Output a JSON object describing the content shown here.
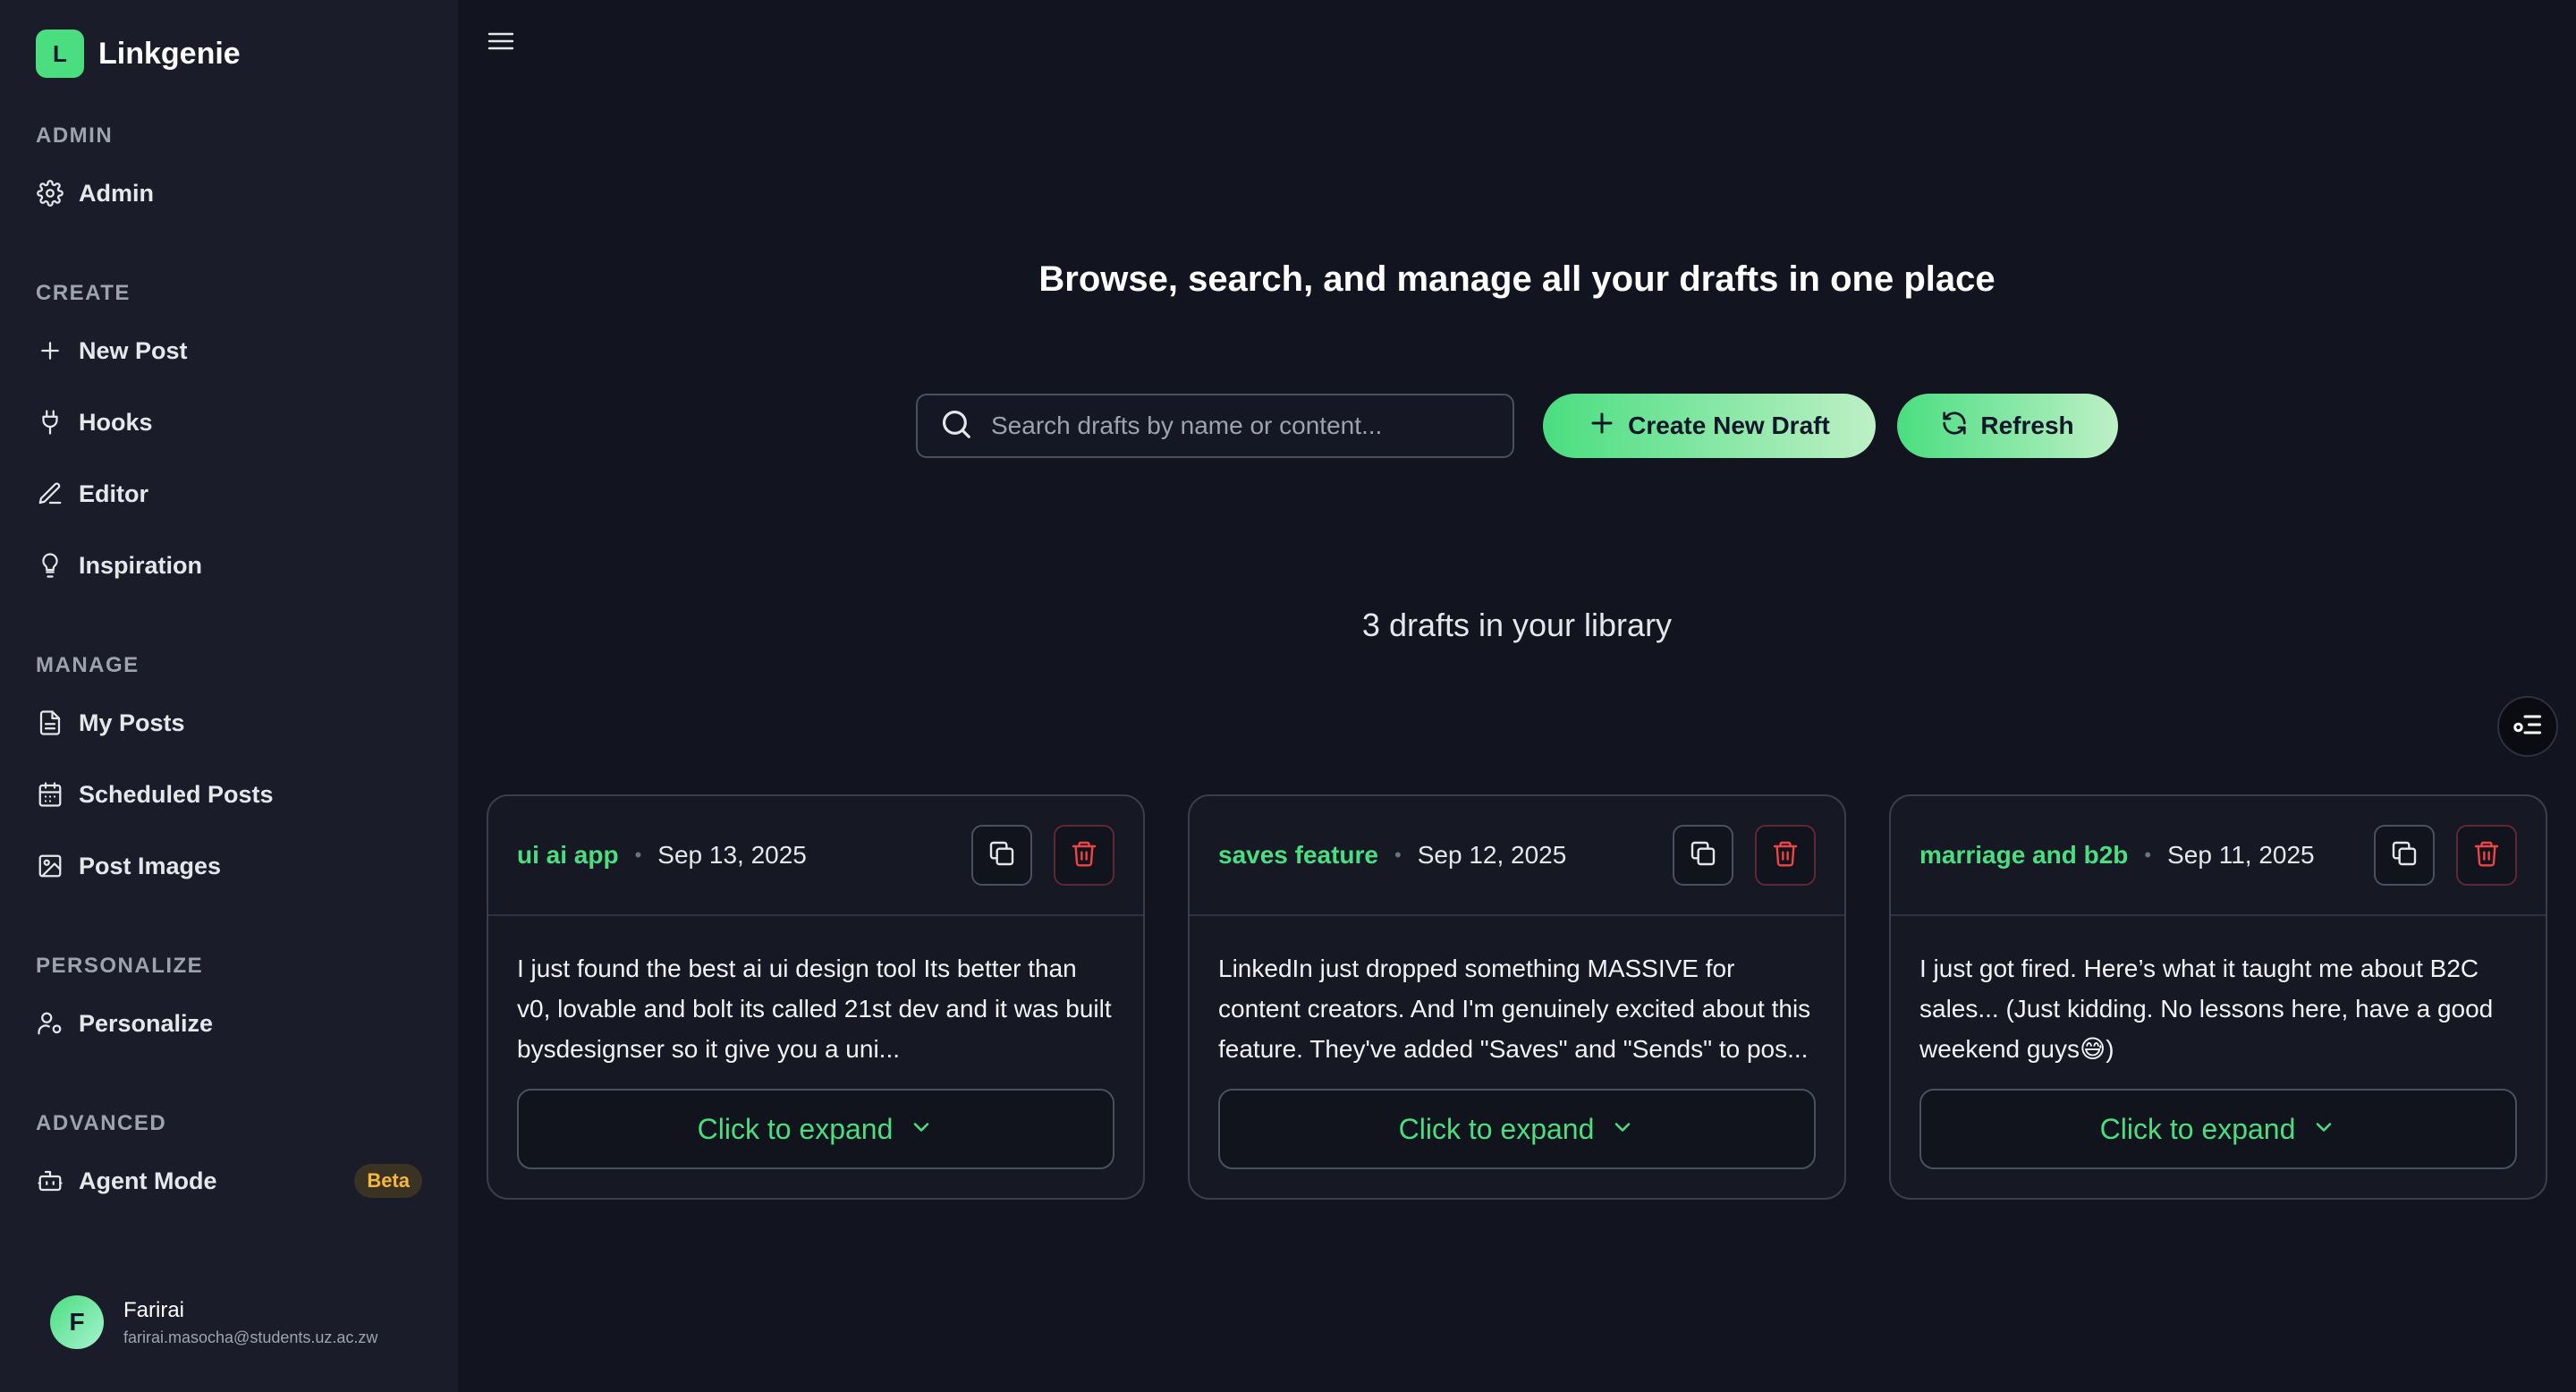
{
  "app": {
    "logo_letter": "L",
    "name": "Linkgenie"
  },
  "sidebar": {
    "sections": [
      {
        "title": "ADMIN",
        "items": [
          {
            "label": "Admin",
            "icon": "gear-icon"
          }
        ]
      },
      {
        "title": "CREATE",
        "items": [
          {
            "label": "New Post",
            "icon": "plus-icon"
          },
          {
            "label": "Hooks",
            "icon": "hook-icon"
          },
          {
            "label": "Editor",
            "icon": "pen-icon"
          },
          {
            "label": "Inspiration",
            "icon": "lightbulb-icon"
          }
        ]
      },
      {
        "title": "MANAGE",
        "items": [
          {
            "label": "My Posts",
            "icon": "document-icon"
          },
          {
            "label": "Scheduled Posts",
            "icon": "calendar-icon"
          },
          {
            "label": "Post Images",
            "icon": "image-icon"
          }
        ]
      },
      {
        "title": "PERSONALIZE",
        "items": [
          {
            "label": "Personalize",
            "icon": "user-settings-icon"
          }
        ]
      },
      {
        "title": "ADVANCED",
        "items": [
          {
            "label": "Agent Mode",
            "icon": "robot-icon",
            "badge": "Beta"
          }
        ]
      }
    ]
  },
  "user": {
    "initial": "F",
    "name": "Farirai",
    "email": "farirai.masocha@students.uz.ac.zw"
  },
  "main": {
    "heading": "Browse, search, and manage all your drafts in one place",
    "search": {
      "placeholder": "Search drafts by name or content...",
      "value": ""
    },
    "create_button": "Create New Draft",
    "refresh_button": "Refresh",
    "count_text": "3 drafts in your library"
  },
  "drafts": [
    {
      "name": "ui ai app",
      "date": "Sep 13, 2025",
      "preview": "I just found the best ai ui design tool Its better than v0, lovable and bolt its called 21st dev and it was built bysdesignser so it give you a uni...",
      "expand_label": "Click to expand"
    },
    {
      "name": "saves feature",
      "date": "Sep 12, 2025",
      "preview": "LinkedIn just dropped something MASSIVE for content creators. And I'm genuinely excited about this feature. They've added \"Saves\" and \"Sends\" to pos...",
      "expand_label": "Click to expand"
    },
    {
      "name": "marriage and b2b",
      "date": "Sep 11, 2025",
      "preview": "I just got fired. Here’s what it taught me about B2C sales... (Just kidding. No lessons here, have a good weekend guys😅)",
      "expand_label": "Click to expand"
    }
  ],
  "colors": {
    "accent": "#4ade80",
    "background": "#121420",
    "sidebar": "#1a1c2a",
    "danger": "#ef4444",
    "beta": "#f5b83d"
  }
}
